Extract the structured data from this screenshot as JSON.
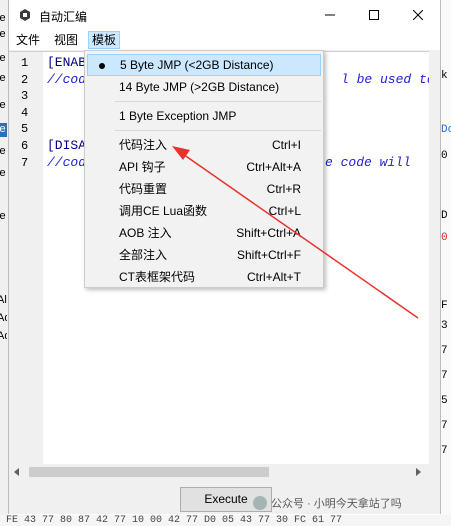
{
  "window": {
    "title": "自动汇编"
  },
  "menubar": {
    "file": "文件",
    "view": "视图",
    "template": "模板"
  },
  "editor": {
    "line_numbers": [
      "1",
      "2",
      "3",
      "4",
      "5",
      "6",
      "7"
    ],
    "line1": "[ENAB",
    "line2": "//cod",
    "line2_tail": "l be used to",
    "line5": "[DISA",
    "line6": "//cod",
    "line6_tail": "e code will"
  },
  "menu": {
    "items": [
      {
        "label": "5 Byte JMP (<2GB Distance)",
        "shortcut": ""
      },
      {
        "label": "14 Byte JMP (>2GB Distance)",
        "shortcut": ""
      },
      {
        "label": "1 Byte Exception JMP",
        "shortcut": ""
      },
      {
        "label": "代码注入",
        "shortcut": "Ctrl+I"
      },
      {
        "label": "API 钩子",
        "shortcut": "Ctrl+Alt+A"
      },
      {
        "label": "代码重置",
        "shortcut": "Ctrl+R"
      },
      {
        "label": "调用CE Lua函数",
        "shortcut": "Ctrl+L"
      },
      {
        "label": "AOB 注入",
        "shortcut": "Shift+Ctrl+A"
      },
      {
        "label": "全部注入",
        "shortcut": "Shift+Ctrl+F"
      },
      {
        "label": "CT表框架代码",
        "shortcut": "Ctrl+Alt+T"
      }
    ]
  },
  "buttons": {
    "execute": "Execute"
  },
  "background": {
    "left_chars": [
      "ie",
      "ie",
      "ie",
      "ie",
      "ie",
      "ie",
      "ie",
      "ie",
      "ie",
      "Al",
      "Ad",
      "Ad"
    ],
    "right_chars": [
      "k",
      "to",
      "Do",
      "0",
      "D",
      "0",
      "F",
      "3",
      "7",
      "7",
      "5",
      "7",
      "7"
    ],
    "bottom_hex": "FE 43 77 80 87 42 77 10 00 42 77 D0 05 43 77 30 FC 61 77"
  },
  "watermark": {
    "text": "公众号 · 小明今天拿站了吗"
  },
  "colors": {
    "menu_highlight": "#cce8ff",
    "annotation_arrow": "#e8322d",
    "comment": "#2222cc"
  }
}
